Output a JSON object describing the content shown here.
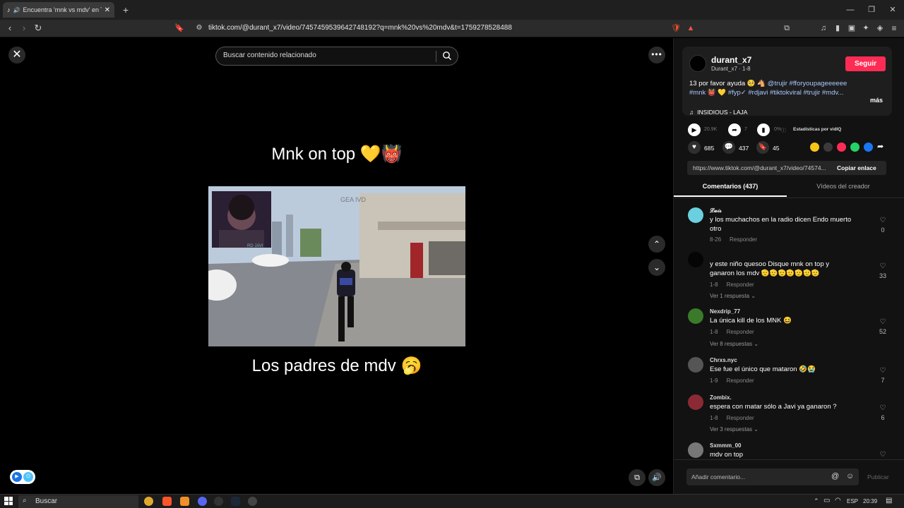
{
  "browser": {
    "tab_title": "Encuentra 'mnk vs mdv' en TikTok",
    "url": "tiktok.com/@durant_x7/video/7457459539642748192?q=mnk%20vs%20mdv&t=1759278528488"
  },
  "video": {
    "search_placeholder": "Buscar contenido relacionado",
    "caption_top": "Mnk on top 💛👹",
    "caption_bottom": "Los padres de mdv 🥱",
    "game_watermark": "GEA IVD",
    "streamer_label": "RD JAVI"
  },
  "creator": {
    "username": "durant_x7",
    "subline": "Durant_x7 · 1-8",
    "follow_label": "Seguir",
    "description_plain": "13 por favor ayuda 🥺 🐴 ",
    "description_tags_1": "@trujir #fforyoupageeeeee",
    "description_tags_2_prefix": "#mnk 👹 💛 ",
    "description_tags_2": "#fyp✓ #rdjavi #tiktokviral #trujir #mdv...",
    "more_label": "más",
    "music_icon": "music-note-icon",
    "music": "INSIDIOUS - LAJA"
  },
  "stats": {
    "plays": "20.9K",
    "shares_small": "7",
    "percent": "0%",
    "vidiq_label": "Estadísticas por vidIQ",
    "likes": "685",
    "comments": "437",
    "saves": "45"
  },
  "link": {
    "url": "https://www.tiktok.com/@durant_x7/video/74574...",
    "copy_label": "Copiar enlace"
  },
  "tabs": {
    "comments": "Comentarios (437)",
    "videos": "Vídeos del creador"
  },
  "comments": [
    {
      "name": "𝓛𝓾𝓲𝓼",
      "text": "y los muchachos en la radio dicen Endo muerto otro",
      "date": "8-26",
      "reply": "Responder",
      "likes": "0",
      "more": ""
    },
    {
      "name": "",
      "text": "y este niño quesoo Disque mnk on top y ganaron los mdv 🫡🫡🫡🫡🫡🫡🫡",
      "date": "1-8",
      "reply": "Responder",
      "likes": "33",
      "more": "Ver 1 respuesta ⌄"
    },
    {
      "name": "Nexdrip_77",
      "text": "La única kill de los MNK 😆",
      "date": "1-8",
      "reply": "Responder",
      "likes": "52",
      "more": "Ver 8 respuestas ⌄"
    },
    {
      "name": "Chrxs.nyc",
      "text": "Ese fue el único que mataron 🤣😭",
      "date": "1-9",
      "reply": "Responder",
      "likes": "7",
      "more": ""
    },
    {
      "name": "Zombix.",
      "text": "espera con matar sólo a Javi ya ganaron ?",
      "date": "1-8",
      "reply": "Responder",
      "likes": "6",
      "more": "Ver 3 respuestas ⌄"
    },
    {
      "name": "Sxmmm_00",
      "text": "mdv on top",
      "date": "",
      "reply": "",
      "likes": "",
      "more": ""
    }
  ],
  "composer": {
    "placeholder": "Añadir comentario...",
    "publish_label": "Publicar"
  },
  "taskbar": {
    "search_label": "Buscar",
    "lang": "ESP",
    "time": "20:39"
  }
}
